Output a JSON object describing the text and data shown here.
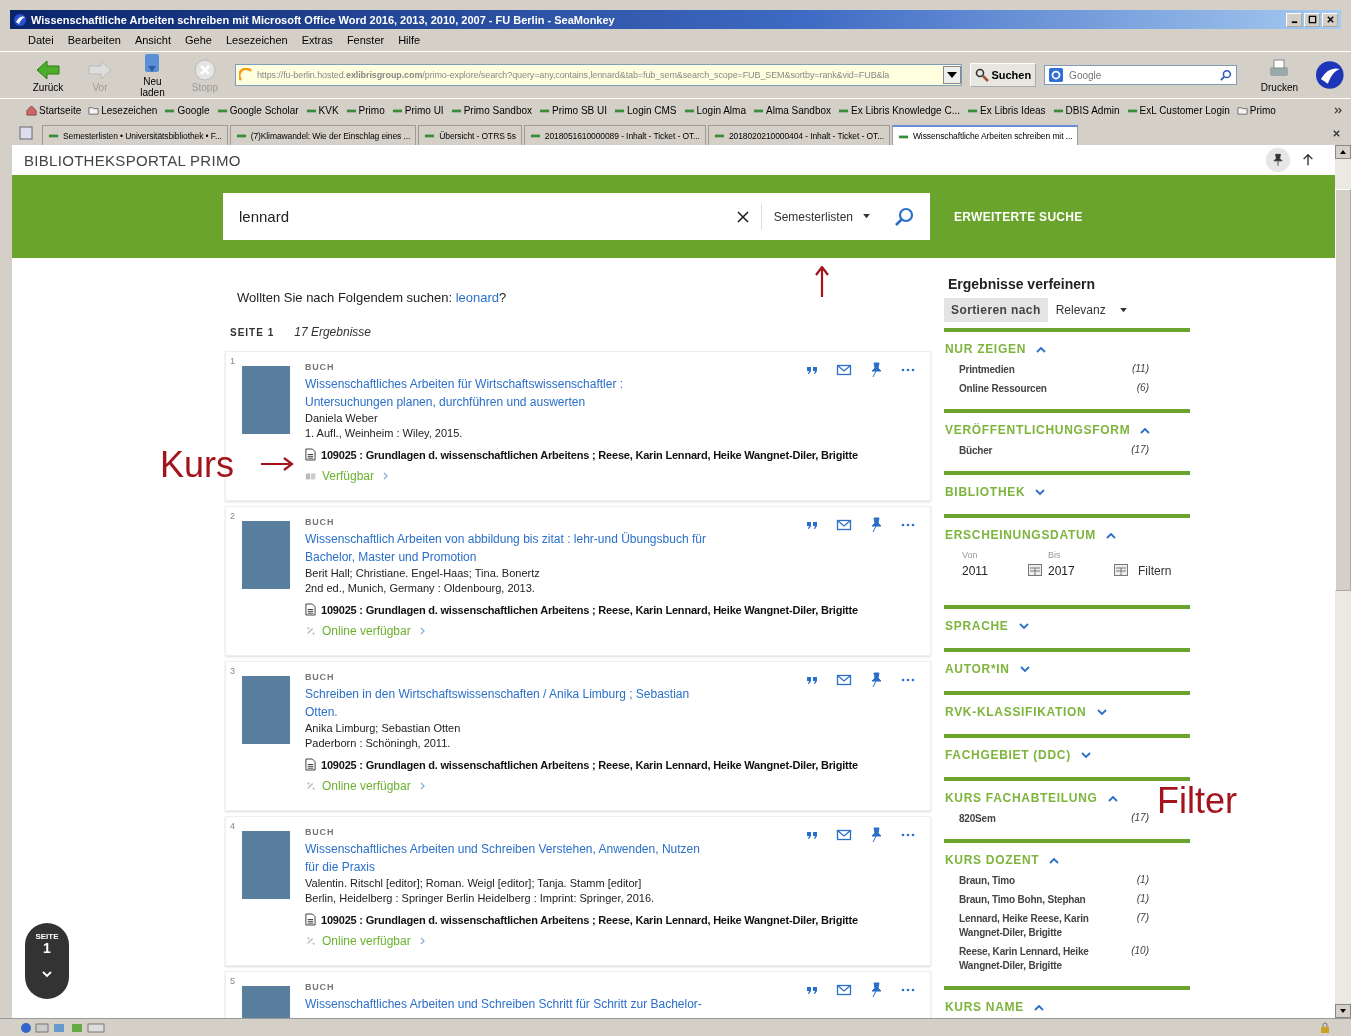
{
  "window": {
    "title": "Wissenschaftliche Arbeiten schreiben mit Microsoft Office Word 2016, 2013, 2010, 2007 - FU Berlin - SeaMonkey"
  },
  "menu": [
    "Datei",
    "Bearbeiten",
    "Ansicht",
    "Gehe",
    "Lesezeichen",
    "Extras",
    "Fenster",
    "Hilfe"
  ],
  "toolbar": {
    "buttons": [
      {
        "kind": "back",
        "label": "Zurück",
        "disabled": false
      },
      {
        "kind": "forward",
        "label": "Vor",
        "disabled": true
      },
      {
        "kind": "reload",
        "label": "Neu laden",
        "disabled": false
      },
      {
        "kind": "stop",
        "label": "Stopp",
        "disabled": true
      }
    ],
    "url": "https://fu-berlin.hosted.**exlibrisgroup.com**/primo-explore/search?query=any,contains,lennard&tab=fub_sem&search_scope=FUB_SEM&sortby=rank&vid=FUB&la",
    "search_button": "Suchen",
    "search_placeholder": "Google",
    "print_button": "Drucken"
  },
  "bookmarks": [
    {
      "kind": "home",
      "label": "Startseite"
    },
    {
      "kind": "folder",
      "label": "Lesezeichen"
    },
    {
      "kind": "link",
      "label": "Google"
    },
    {
      "kind": "link",
      "label": "Google Scholar"
    },
    {
      "kind": "link",
      "label": "KVK"
    },
    {
      "kind": "link",
      "label": "Primo"
    },
    {
      "kind": "link",
      "label": "Primo UI"
    },
    {
      "kind": "link",
      "label": "Primo Sandbox"
    },
    {
      "kind": "link",
      "label": "Primo SB UI"
    },
    {
      "kind": "link",
      "label": "Login CMS"
    },
    {
      "kind": "link",
      "label": "Login Alma"
    },
    {
      "kind": "link",
      "label": "Alma Sandbox"
    },
    {
      "kind": "link",
      "label": "Ex Libris Knowledge C..."
    },
    {
      "kind": "link",
      "label": "Ex Libris Ideas"
    },
    {
      "kind": "link",
      "label": "DBIS Admin"
    },
    {
      "kind": "link",
      "label": "ExL Customer Login"
    },
    {
      "kind": "folder",
      "label": "Primo"
    }
  ],
  "tabs": [
    {
      "label": "Semesterlisten • Universitätsbibliothek • F...",
      "selected": false
    },
    {
      "label": "(7)Klimawandel: Wie der Einschlag eines ...",
      "selected": false
    },
    {
      "label": "Übersicht - OTRS 5s",
      "selected": false
    },
    {
      "label": "2018051610000089 - Inhalt - Ticket - OT...",
      "selected": false
    },
    {
      "label": "2018020210000404 - Inhalt - Ticket - OT...",
      "selected": false
    },
    {
      "label": "Wissenschaftliche Arbeiten schreiben mit ...",
      "selected": true
    }
  ],
  "primo": {
    "brand": "BIBLIOTHEKSPORTAL PRIMO",
    "search_value": "lennard",
    "scope": "Semesterlisten",
    "advanced": "ERWEITERTE SUCHE",
    "did_you_mean": "Wollten Sie nach Folgendem suchen:",
    "suggestion": "leonard",
    "suggestion_suffix": "?",
    "page_label": "SEITE 1",
    "count": "17 Ergebnisse"
  },
  "results": [
    {
      "number": "1",
      "type": "BUCH",
      "title": "Wissenschaftliches Arbeiten für Wirtschaftswissenschaftler : Untersuchungen planen, durchführen und auswerten",
      "authors": "Daniela Weber",
      "publication": "1. Aufl., Weinheim : Wiley, 2015.",
      "course": "109025 : Grundlagen d. wissenschaftlichen Arbeitens ; Reese, Karin Lennard, Heike Wangnet-Diler, Brigitte",
      "kind": "print",
      "availability": "Verfügbar"
    },
    {
      "number": "2",
      "type": "BUCH",
      "title": "Wissenschaftlich Arbeiten von abbildung bis zitat : lehr-und Übungsbuch für Bachelor, Master und Promotion",
      "authors": "Berit Hall; Christiane. Engel-Haas; Tina. Bonertz",
      "publication": "2nd ed., Munich, Germany : Oldenbourg, 2013.",
      "course": "109025 : Grundlagen d. wissenschaftlichen Arbeitens ; Reese, Karin Lennard, Heike Wangnet-Diler, Brigitte",
      "kind": "online",
      "availability": "Online verfügbar"
    },
    {
      "number": "3",
      "type": "BUCH",
      "title": "Schreiben in den Wirtschaftswissenschaften / Anika Limburg ; Sebastian Otten.",
      "authors": "Anika Limburg; Sebastian Otten",
      "publication": "Paderborn : Schöningh, 2011.",
      "course": "109025 : Grundlagen d. wissenschaftlichen Arbeitens ; Reese, Karin Lennard, Heike Wangnet-Diler, Brigitte",
      "kind": "online",
      "availability": "Online verfügbar"
    },
    {
      "number": "4",
      "type": "BUCH",
      "title": "Wissenschaftliches Arbeiten und Schreiben Verstehen, Anwenden, Nutzen für die Praxis",
      "authors": "Valentin. Ritschl [editor]; Roman. Weigl [editor]; Tanja. Stamm [editor]",
      "publication": "Berlin, Heidelberg : Springer Berlin Heidelberg : Imprint: Springer, 2016.",
      "course": "109025 : Grundlagen d. wissenschaftlichen Arbeitens ; Reese, Karin Lennard, Heike Wangnet-Diler, Brigitte",
      "kind": "online",
      "availability": "Online verfügbar"
    },
    {
      "number": "5",
      "type": "BUCH",
      "title": "Wissenschaftliches Arbeiten und Schreiben Schritt für Schritt zur Bachelor-"
    }
  ],
  "page_badge": {
    "label": "SEITE",
    "number": "1"
  },
  "sidebar": {
    "title": "Ergebnisse verfeinern",
    "sort_label": "Sortieren nach",
    "sort_value": "Relevanz",
    "facets": [
      {
        "kind": "list",
        "title": "NUR ZEIGEN",
        "expanded": true,
        "items": [
          {
            "label": "Printmedien",
            "count": "(11)"
          },
          {
            "label": "Online Ressourcen",
            "count": "(6)"
          }
        ]
      },
      {
        "kind": "list",
        "title": "VERÖFFENTLICHUNGSFORM",
        "expanded": true,
        "items": [
          {
            "label": "Bücher",
            "count": "(17)"
          }
        ]
      },
      {
        "kind": "list",
        "title": "BIBLIOTHEK",
        "expanded": false
      },
      {
        "kind": "date",
        "title": "ERSCHEINUNGSDATUM",
        "expanded": true,
        "from_label": "Von",
        "from": "2011",
        "to_label": "Bis",
        "to": "2017",
        "button": "Filtern"
      },
      {
        "kind": "list",
        "title": "SPRACHE",
        "expanded": false
      },
      {
        "kind": "list",
        "title": "AUTOR*IN",
        "expanded": false
      },
      {
        "kind": "list",
        "title": "RVK-KLASSIFIKATION",
        "expanded": false
      },
      {
        "kind": "list",
        "title": "FACHGEBIET (DDC)",
        "expanded": false
      },
      {
        "kind": "list",
        "title": "KURS FACHABTEILUNG",
        "expanded": true,
        "items": [
          {
            "label": "820Sem",
            "count": "(17)"
          }
        ]
      },
      {
        "kind": "list",
        "title": "KURS DOZENT",
        "expanded": true,
        "items": [
          {
            "label": "Braun, Timo",
            "count": "(1)"
          },
          {
            "label": "Braun, Timo Bohn, Stephan",
            "count": "(1)"
          },
          {
            "label": "Lennard, Heike Reese, Karin Wangnet-Diler, Brigitte",
            "count": "(7)"
          },
          {
            "label": "Reese, Karin Lennard, Heike Wangnet-Diler, Brigitte",
            "count": "(10)"
          }
        ]
      },
      {
        "kind": "list",
        "title": "KURS NAME",
        "expanded": true
      }
    ]
  },
  "annotations": [
    "Kurs",
    "Filter"
  ]
}
